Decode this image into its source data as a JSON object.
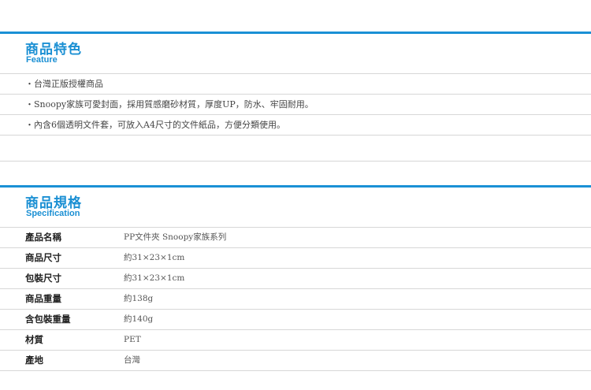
{
  "feature": {
    "title": "商品特色",
    "subtitle": "Feature",
    "items": [
      "・台灣正版授權商品",
      "・Snoopy家族可愛封面，採用質感磨砂材質，厚度UP，防水、牢固耐用。",
      "・內含6個透明文件套，可放入A4尺寸的文件紙品，方便分類使用。"
    ]
  },
  "spec": {
    "title": "商品規格",
    "subtitle": "Specification",
    "rows": [
      {
        "label": "產品名稱",
        "value": "PP文件夾 Snoopy家族系列"
      },
      {
        "label": "商品尺寸",
        "value": "約31×23×1cm"
      },
      {
        "label": "包裝尺寸",
        "value": "約31×23×1cm"
      },
      {
        "label": "商品重量",
        "value": "約138g"
      },
      {
        "label": "含包裝重量",
        "value": "約140g"
      },
      {
        "label": "材質",
        "value": "PET"
      },
      {
        "label": "產地",
        "value": "台灣"
      }
    ]
  },
  "colors": {
    "accent": "#1a90d5",
    "divider": "#d7d7d7"
  }
}
